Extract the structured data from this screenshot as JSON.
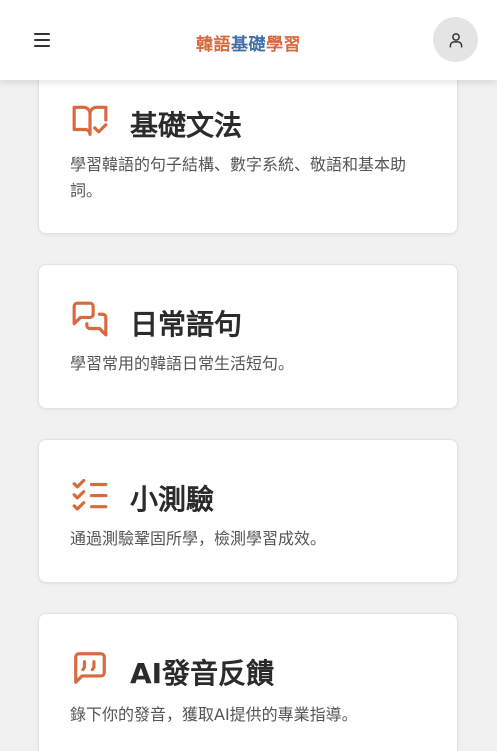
{
  "header": {
    "brand_part1": "韓語",
    "brand_part2": "基礎",
    "brand_part3": "學習",
    "brand_colors": {
      "accent": "#d9693e",
      "secondary": "#3f6ea8"
    },
    "menu_icon": "hamburger-menu-icon",
    "user_icon": "user-icon"
  },
  "cards": [
    {
      "icon": "book-check-icon",
      "title": "基礎文法",
      "description": "學習韓語的句子結構、數字系統、敬語和基本助詞。"
    },
    {
      "icon": "chat-bubbles-icon",
      "title": "日常語句",
      "description": "學習常用的韓語日常生活短句。"
    },
    {
      "icon": "checklist-icon",
      "title": "小測驗",
      "description": "通過測驗鞏固所學，檢測學習成效。"
    },
    {
      "icon": "quote-bubble-icon",
      "title": "AI發音反饋",
      "description": "錄下你的發音，獲取AI提供的專業指導。"
    }
  ]
}
